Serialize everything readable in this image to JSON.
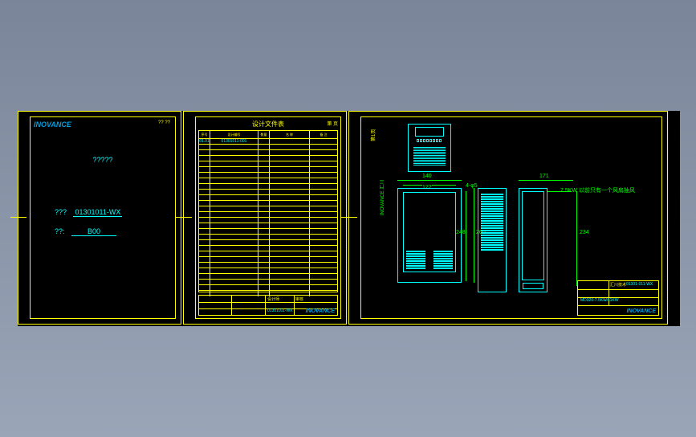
{
  "brand": "INOVANCE",
  "sheet1": {
    "title": "?????",
    "code_label": "???",
    "code_value": "01301011-WX",
    "ver_label": "??:",
    "ver_value": "B00",
    "corner": "??  ??"
  },
  "sheet2": {
    "title": "设计文件表",
    "top_right": "第  页",
    "headers": [
      "序号",
      "设计编号",
      "数量",
      "名    称",
      "备  注"
    ],
    "rows": [
      [
        "01.01",
        "01301011-001",
        "",
        "",
        ""
      ],
      [
        "",
        "",
        "",
        "",
        ""
      ],
      [
        "",
        "",
        "",
        "",
        ""
      ],
      [
        "",
        "",
        "",
        "",
        ""
      ]
    ],
    "footer_label1": "设计师",
    "footer_label2": "审核",
    "footer_code": "01301011-WX"
  },
  "sheet3": {
    "dims": {
      "w_outer": "140",
      "w_inner": "122",
      "side_w": "171",
      "hole": "4-φ5",
      "h_outer": "260",
      "h_inner": "248",
      "h_side": "234"
    },
    "note": "7.5KW 以前只有一个风扇抽风",
    "leftbar": "INOVANCE 汇川",
    "topbar": "第1页",
    "tb": {
      "proj": "汇川技术",
      "part": "01301-011-WX",
      "model": "MD320-7.5KW/11KW"
    }
  }
}
